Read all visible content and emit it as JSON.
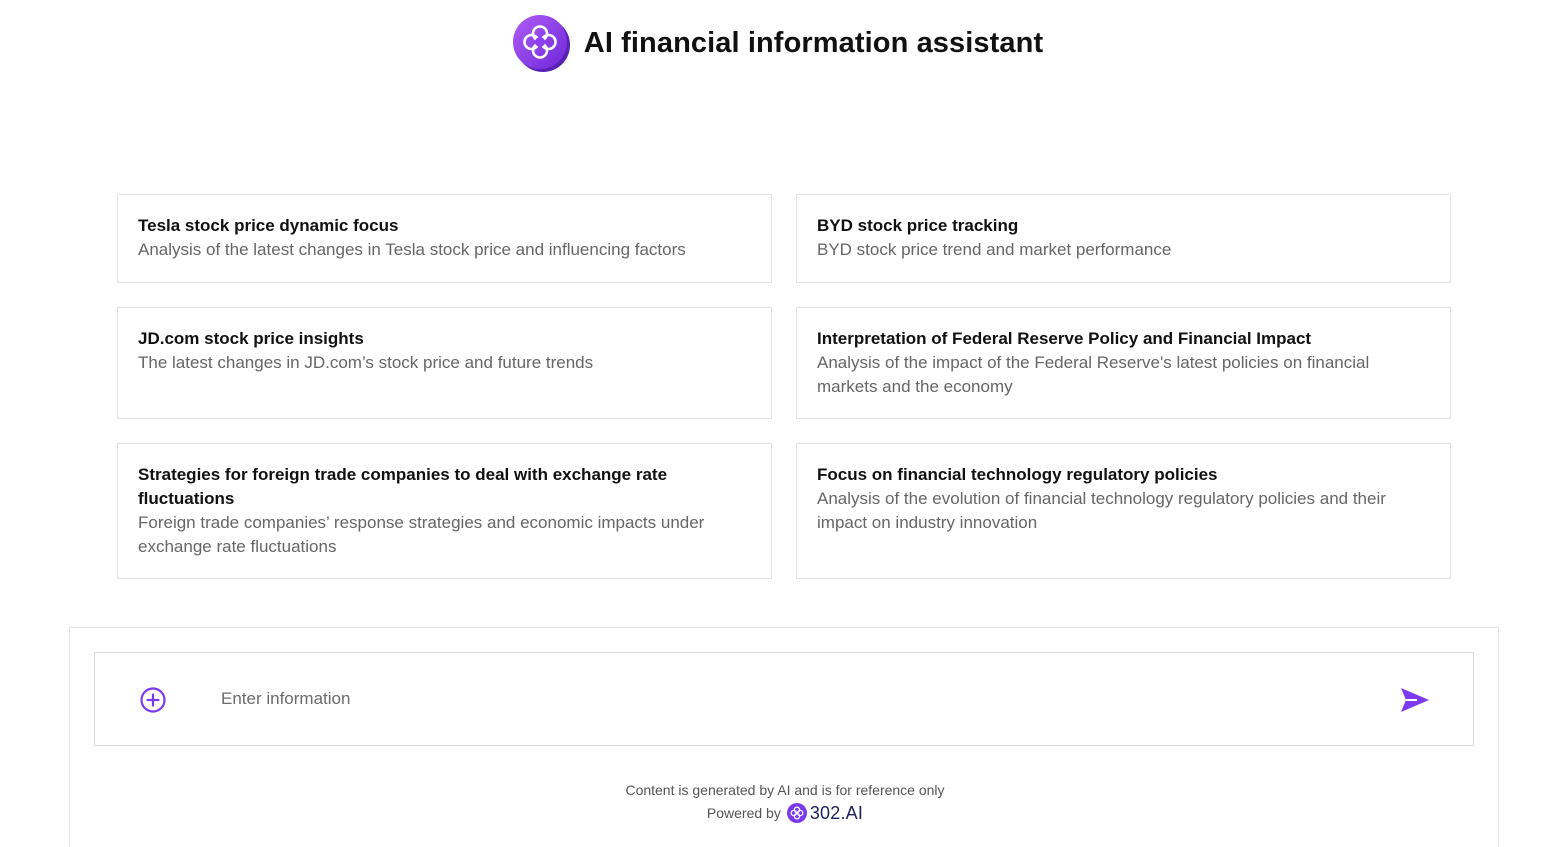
{
  "header": {
    "title": "AI financial information assistant",
    "logo_icon": "clover-logo-icon"
  },
  "cards": [
    {
      "title": "Tesla stock price dynamic focus",
      "description": "Analysis of the latest changes in Tesla stock price and influencing factors"
    },
    {
      "title": "BYD stock price tracking",
      "description": "BYD stock price trend and market performance"
    },
    {
      "title": "JD.com stock price insights",
      "description": "The latest changes in JD.com’s stock price and future trends"
    },
    {
      "title": "Interpretation of Federal Reserve Policy and Financial Impact",
      "description": "Analysis of the impact of the Federal Reserve's latest policies on financial markets and the economy"
    },
    {
      "title": "Strategies for foreign trade companies to deal with exchange rate fluctuations",
      "description": "Foreign trade companies’ response strategies and economic impacts under exchange rate fluctuations"
    },
    {
      "title": "Focus on financial technology regulatory policies",
      "description": "Analysis of the evolution of financial technology regulatory policies and their impact on industry innovation"
    }
  ],
  "input": {
    "placeholder": "Enter information",
    "value": "",
    "add_icon": "plus-circle-icon",
    "send_icon": "send-icon"
  },
  "footer": {
    "disclaimer": "Content is generated by AI and is for reference only",
    "powered_by": "Powered by",
    "brand": "302.AI"
  },
  "colors": {
    "accent": "#7c3aed",
    "logo_gradient_start": "#a855f7",
    "logo_gradient_end": "#6d28d9",
    "card_border": "#e3e3e3",
    "muted_text": "#666666"
  }
}
